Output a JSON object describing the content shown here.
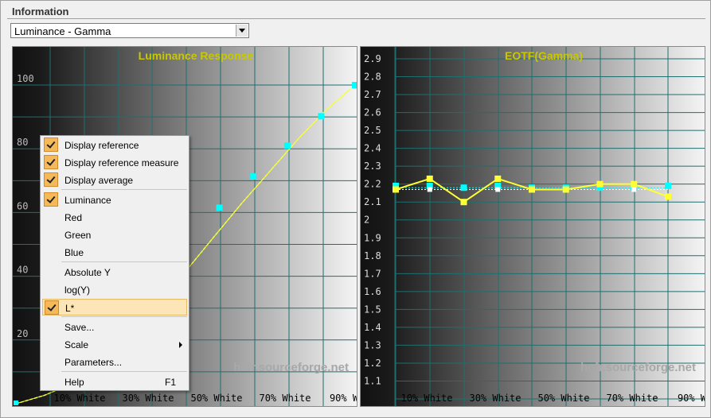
{
  "panel": {
    "title": "Information"
  },
  "combo": {
    "value": "Luminance - Gamma"
  },
  "watermark": "hcfr.sourceforge.net",
  "colors": {
    "series": "#ffff33",
    "reference": "#d8ff50",
    "marker": "#00ffff",
    "title": "#c8c800"
  },
  "charts": [
    {
      "title": "Luminance Response",
      "chart_data": {
        "type": "line",
        "title": "Luminance Response",
        "ylim": [
          0,
          102
        ],
        "y_ticks": [
          "20",
          "40",
          "60",
          "80",
          "100"
        ],
        "x_tick_labels": [
          "10% White",
          "30% White",
          "50% White",
          "70% White",
          "90% W"
        ],
        "x": [
          0,
          10,
          20,
          30,
          40,
          50,
          60,
          70,
          80,
          90,
          100
        ],
        "series": [
          {
            "values": [
              0,
              2.6,
              6.3,
              13.0,
              21.6,
              30.9,
              41.5,
              52.3,
              63.0,
              73.1,
              83.2,
              92.4,
              100
            ]
          }
        ],
        "markers_x": [
          60,
          70,
          80,
          90,
          100
        ],
        "markers_y": [
          61.5,
          71.3,
          81.0,
          90.2,
          100
        ]
      }
    },
    {
      "title": "EOTF(Gamma)",
      "chart_data": {
        "type": "line",
        "title": "EOTF(Gamma)",
        "ylim": [
          1.0,
          2.95
        ],
        "y_ticks": [
          "1.1",
          "1.2",
          "1.3",
          "1.4",
          "1.5",
          "1.6",
          "1.7",
          "1.8",
          "1.9",
          "2",
          "2.1",
          "2.2",
          "2.3",
          "2.4",
          "2.5",
          "2.6",
          "2.7",
          "2.8",
          "2.9"
        ],
        "x_tick_labels": [
          "10% White",
          "30% White",
          "50% White",
          "70% White",
          "90% W"
        ],
        "x": [
          10,
          20,
          30,
          40,
          50,
          60,
          70,
          80,
          90
        ],
        "series": [
          {
            "values": [
              2.17,
              2.23,
              2.1,
              2.23,
              2.17,
              2.17,
              2.2,
              2.2,
              2.13
            ]
          },
          {
            "values": [
              2.19,
              2.19,
              2.18,
              2.19,
              2.18,
              2.18,
              2.18,
              2.18,
              2.19
            ]
          }
        ],
        "reference": 2.17,
        "average": 2.18
      }
    }
  ],
  "menu": {
    "items": [
      {
        "label": "Display reference",
        "checked": true
      },
      {
        "label": "Display reference measure",
        "checked": true
      },
      {
        "label": "Display average",
        "checked": true
      },
      {
        "label": "Luminance",
        "checked": true
      },
      {
        "label": "Red",
        "checked": false
      },
      {
        "label": "Green",
        "checked": false
      },
      {
        "label": "Blue",
        "checked": false
      },
      {
        "label": "Absolute Y",
        "checked": false
      },
      {
        "label": "log(Y)",
        "checked": false
      },
      {
        "label": "L*",
        "checked": true,
        "highlighted": true
      },
      {
        "label": "Save...",
        "checked": false
      },
      {
        "label": "Scale",
        "checked": false,
        "submenu": true
      },
      {
        "label": "Parameters...",
        "checked": false
      },
      {
        "label": "Help",
        "shortcut": "F1",
        "checked": false
      }
    ]
  }
}
